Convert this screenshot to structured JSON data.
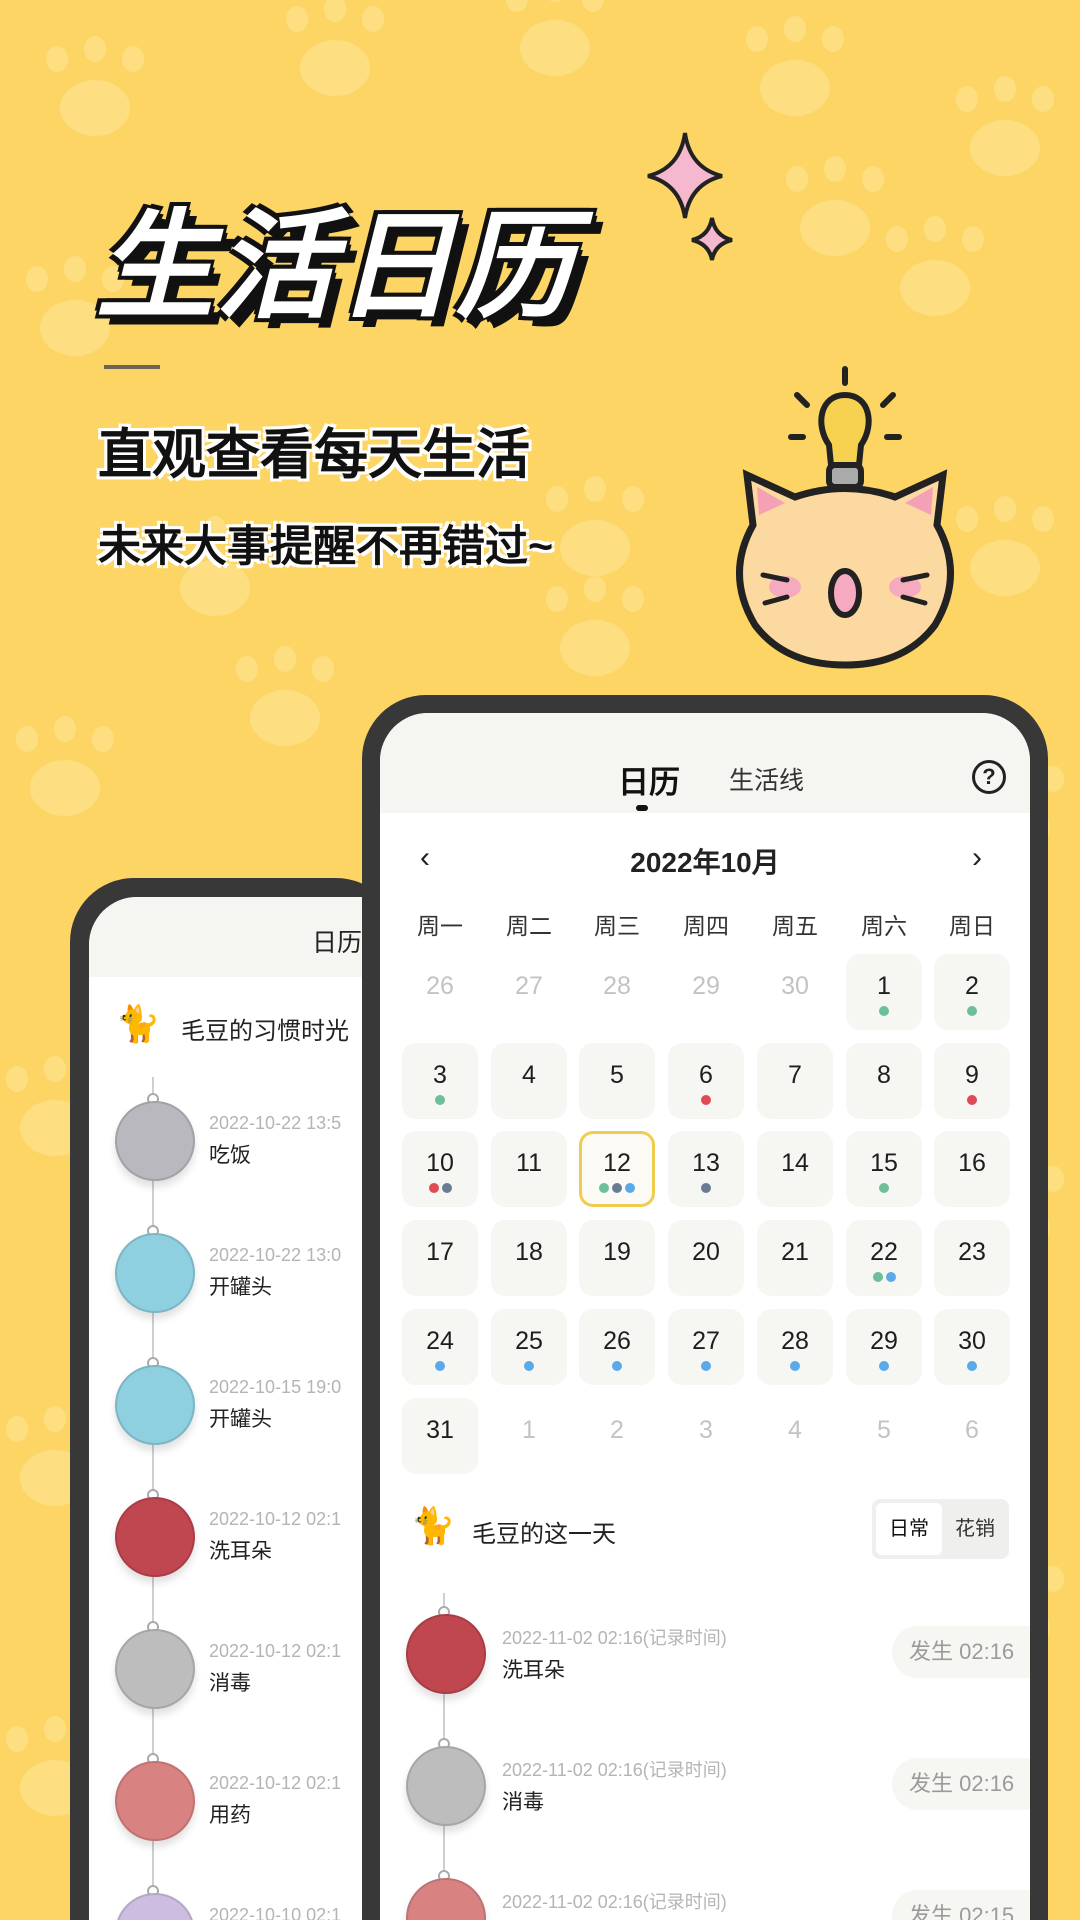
{
  "promo": {
    "title": "生活日历",
    "subtitle": "直观查看每天生活",
    "tagline": "未来大事提醒不再错过~"
  },
  "colors": {
    "background": "#fcd565",
    "dot_green": "#6cbf98",
    "dot_red": "#e04a55",
    "dot_slate": "#687d93",
    "dot_blue": "#5aaae9",
    "selected_border": "#f0cd4f"
  },
  "back_screen": {
    "tab": "日历",
    "pet_title": "毛豆的习惯时光",
    "items": [
      {
        "date": "2022-10-22 13:5",
        "name": "吃饭",
        "icon": "food-bowl-icon",
        "color": "#b8b8be"
      },
      {
        "date": "2022-10-22 13:0",
        "name": "开罐头",
        "icon": "canned-food-icon",
        "color": "#8ecfe0"
      },
      {
        "date": "2022-10-15 19:0",
        "name": "开罐头",
        "icon": "canned-food-icon",
        "color": "#8ecfe0"
      },
      {
        "date": "2022-10-12 02:1",
        "name": "洗耳朵",
        "icon": "cat-ear-clean-icon",
        "color": "#c04650"
      },
      {
        "date": "2022-10-12 02:1",
        "name": "消毒",
        "icon": "disinfectant-bottle-icon",
        "color": "#bdbdbd"
      },
      {
        "date": "2022-10-12 02:1",
        "name": "用药",
        "icon": "medicine-bottle-icon",
        "color": "#d98282"
      },
      {
        "date": "2022-10-10 02:1",
        "name": "",
        "icon": "pet-icon",
        "color": "#cdbde0"
      }
    ]
  },
  "front_screen": {
    "tabs": [
      {
        "label": "日历",
        "active": true
      },
      {
        "label": "生活线",
        "active": false
      }
    ],
    "help_icon": "question-circle-icon",
    "month_label": "2022年10月",
    "prev_icon": "chevron-left-icon",
    "next_icon": "chevron-right-icon",
    "weekdays": [
      "周一",
      "周二",
      "周三",
      "周四",
      "周五",
      "周六",
      "周日"
    ],
    "days": [
      {
        "d": "26",
        "cur": false
      },
      {
        "d": "27",
        "cur": false
      },
      {
        "d": "28",
        "cur": false
      },
      {
        "d": "29",
        "cur": false
      },
      {
        "d": "30",
        "cur": false
      },
      {
        "d": "1",
        "cur": true,
        "dots": [
          "green"
        ]
      },
      {
        "d": "2",
        "cur": true,
        "dots": [
          "green"
        ]
      },
      {
        "d": "3",
        "cur": true,
        "dots": [
          "green"
        ]
      },
      {
        "d": "4",
        "cur": true
      },
      {
        "d": "5",
        "cur": true
      },
      {
        "d": "6",
        "cur": true,
        "dots": [
          "red"
        ]
      },
      {
        "d": "7",
        "cur": true
      },
      {
        "d": "8",
        "cur": true
      },
      {
        "d": "9",
        "cur": true,
        "dots": [
          "red"
        ]
      },
      {
        "d": "10",
        "cur": true,
        "dots": [
          "red",
          "slate"
        ]
      },
      {
        "d": "11",
        "cur": true
      },
      {
        "d": "12",
        "cur": true,
        "selected": true,
        "dots": [
          "green",
          "slate",
          "blue"
        ]
      },
      {
        "d": "13",
        "cur": true,
        "dots": [
          "slate"
        ]
      },
      {
        "d": "14",
        "cur": true
      },
      {
        "d": "15",
        "cur": true,
        "dots": [
          "green"
        ]
      },
      {
        "d": "16",
        "cur": true
      },
      {
        "d": "17",
        "cur": true
      },
      {
        "d": "18",
        "cur": true
      },
      {
        "d": "19",
        "cur": true
      },
      {
        "d": "20",
        "cur": true
      },
      {
        "d": "21",
        "cur": true
      },
      {
        "d": "22",
        "cur": true,
        "dots": [
          "green",
          "blue"
        ]
      },
      {
        "d": "23",
        "cur": true
      },
      {
        "d": "24",
        "cur": true,
        "dots": [
          "blue"
        ]
      },
      {
        "d": "25",
        "cur": true,
        "dots": [
          "blue"
        ]
      },
      {
        "d": "26",
        "cur": true,
        "dots": [
          "blue"
        ]
      },
      {
        "d": "27",
        "cur": true,
        "dots": [
          "blue"
        ]
      },
      {
        "d": "28",
        "cur": true,
        "dots": [
          "blue"
        ]
      },
      {
        "d": "29",
        "cur": true,
        "dots": [
          "blue"
        ]
      },
      {
        "d": "30",
        "cur": true,
        "dots": [
          "blue"
        ]
      },
      {
        "d": "31",
        "cur": true
      },
      {
        "d": "1",
        "cur": false
      },
      {
        "d": "2",
        "cur": false
      },
      {
        "d": "3",
        "cur": false
      },
      {
        "d": "4",
        "cur": false
      },
      {
        "d": "5",
        "cur": false
      },
      {
        "d": "6",
        "cur": false
      }
    ],
    "day_title": "毛豆的这一天",
    "segment": [
      {
        "label": "日常",
        "active": true
      },
      {
        "label": "花销",
        "active": false
      }
    ],
    "items": [
      {
        "date": "2022-11-02 02:16(记录时间)",
        "name": "洗耳朵",
        "time": "发生 02:16",
        "icon": "cat-ear-clean-icon",
        "color": "#c04650"
      },
      {
        "date": "2022-11-02 02:16(记录时间)",
        "name": "消毒",
        "time": "发生 02:16",
        "icon": "disinfectant-bottle-icon",
        "color": "#bdbdbd"
      },
      {
        "date": "2022-11-02 02:16(记录时间)",
        "name": "",
        "time": "发生 02:15",
        "icon": "medicine-bottle-icon",
        "color": "#d98282"
      }
    ]
  }
}
